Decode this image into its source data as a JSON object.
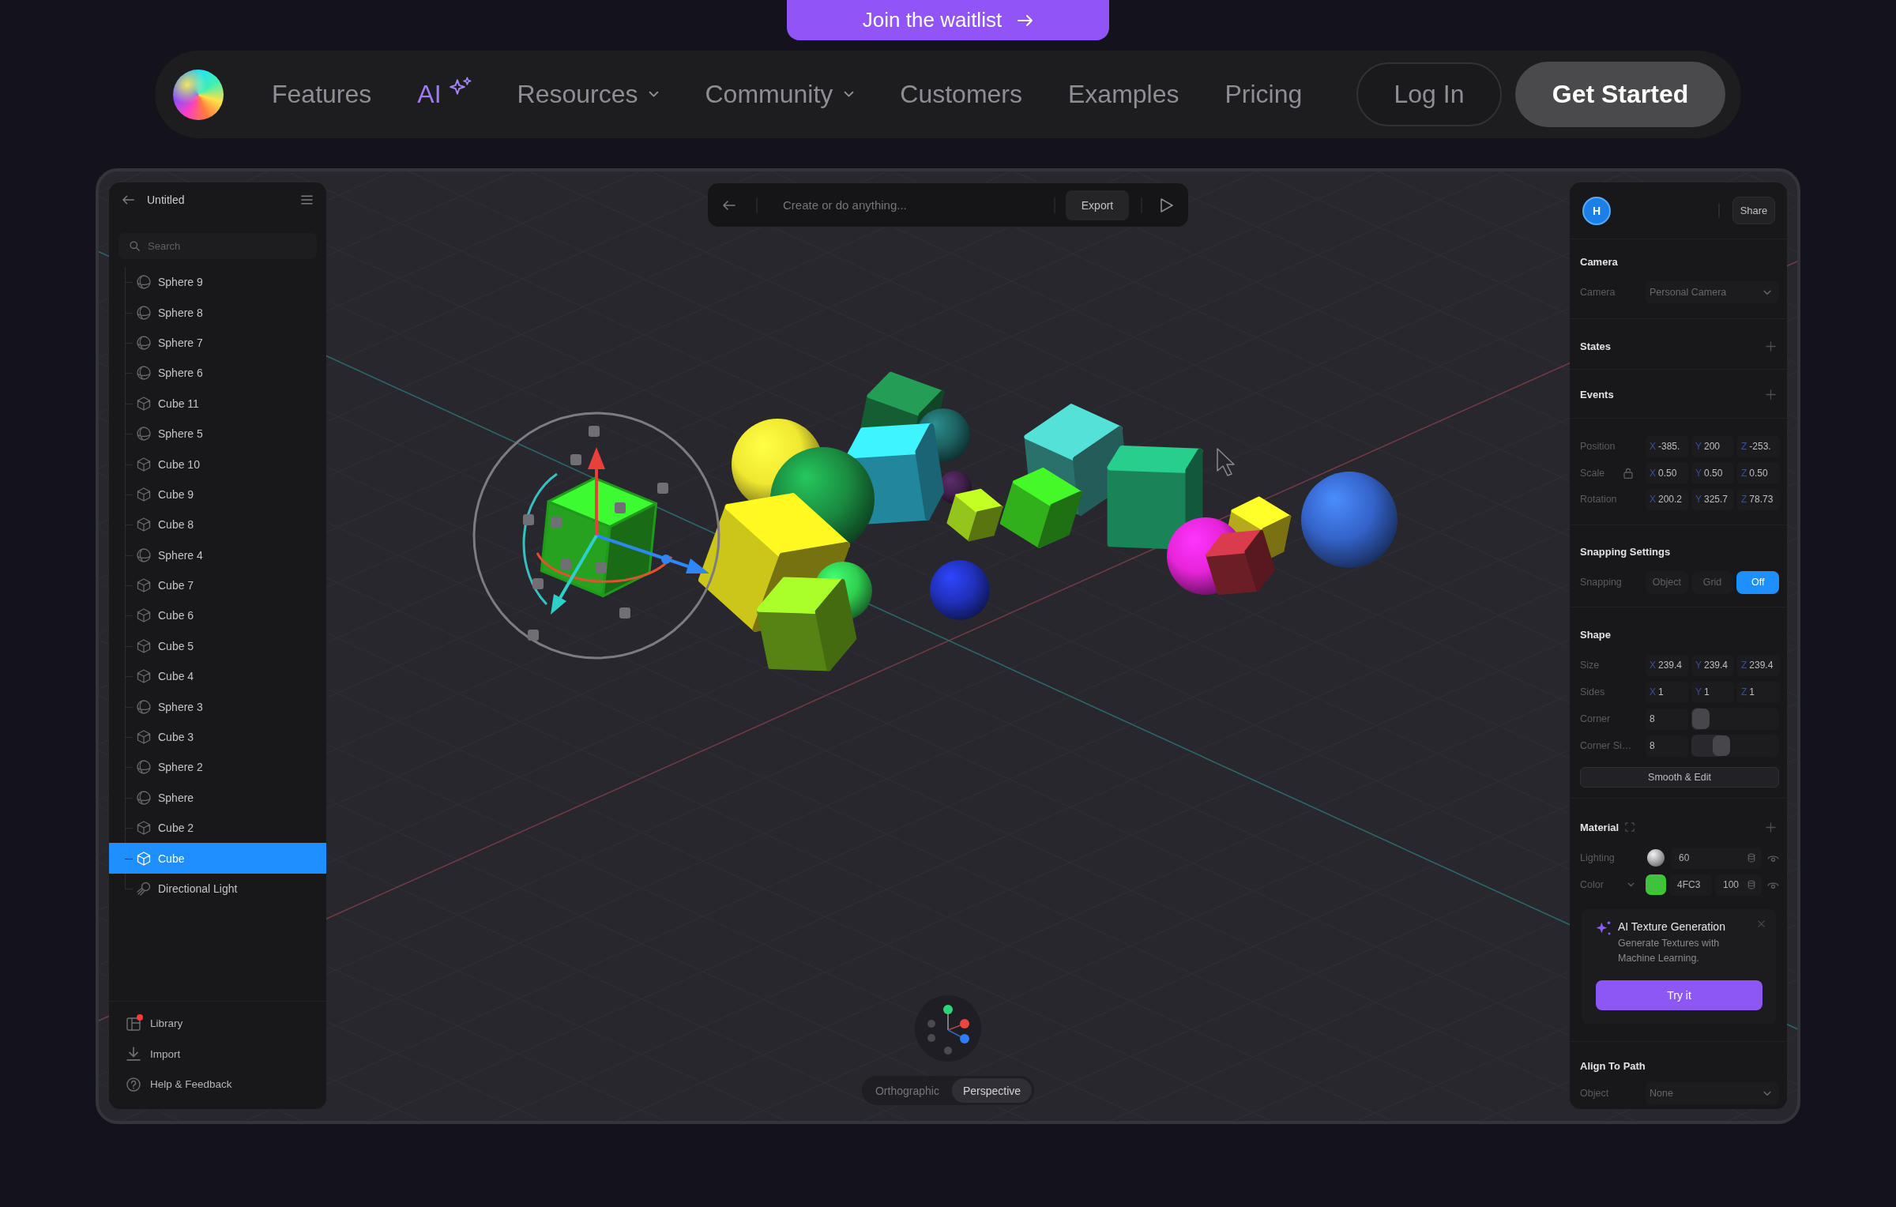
{
  "waitlist_button": {
    "label": "Join the waitlist"
  },
  "nav": {
    "links": [
      {
        "label": "Features",
        "kind": "link"
      },
      {
        "label": "AI",
        "kind": "ai"
      },
      {
        "label": "Resources",
        "kind": "dropdown"
      },
      {
        "label": "Community",
        "kind": "dropdown"
      },
      {
        "label": "Customers",
        "kind": "link"
      },
      {
        "label": "Examples",
        "kind": "link"
      },
      {
        "label": "Pricing",
        "kind": "link"
      }
    ],
    "login": "Log In",
    "cta": "Get Started"
  },
  "layers_panel": {
    "title": "Untitled",
    "search": {
      "placeholder": "Search"
    },
    "layers": [
      {
        "label": "Sphere 9",
        "kind": "sphere",
        "selected": false
      },
      {
        "label": "Sphere 8",
        "kind": "sphere",
        "selected": false
      },
      {
        "label": "Sphere 7",
        "kind": "sphere",
        "selected": false
      },
      {
        "label": "Sphere 6",
        "kind": "sphere",
        "selected": false
      },
      {
        "label": "Cube 11",
        "kind": "cube",
        "selected": false
      },
      {
        "label": "Sphere 5",
        "kind": "sphere",
        "selected": false
      },
      {
        "label": "Cube 10",
        "kind": "cube",
        "selected": false
      },
      {
        "label": "Cube 9",
        "kind": "cube",
        "selected": false
      },
      {
        "label": "Cube 8",
        "kind": "cube",
        "selected": false
      },
      {
        "label": "Sphere 4",
        "kind": "sphere",
        "selected": false
      },
      {
        "label": "Cube 7",
        "kind": "cube",
        "selected": false
      },
      {
        "label": "Cube 6",
        "kind": "cube",
        "selected": false
      },
      {
        "label": "Cube 5",
        "kind": "cube",
        "selected": false
      },
      {
        "label": "Cube 4",
        "kind": "cube",
        "selected": false
      },
      {
        "label": "Sphere 3",
        "kind": "sphere",
        "selected": false
      },
      {
        "label": "Cube 3",
        "kind": "cube",
        "selected": false
      },
      {
        "label": "Sphere 2",
        "kind": "sphere",
        "selected": false
      },
      {
        "label": "Sphere",
        "kind": "sphere",
        "selected": false
      },
      {
        "label": "Cube 2",
        "kind": "cube",
        "selected": false
      },
      {
        "label": "Cube",
        "kind": "cube",
        "selected": true
      },
      {
        "label": "Directional Light",
        "kind": "light",
        "selected": false
      }
    ],
    "footer": [
      {
        "label": "Library",
        "kind": "library",
        "notification": true
      },
      {
        "label": "Import",
        "kind": "import",
        "notification": false
      },
      {
        "label": "Help & Feedback",
        "kind": "help",
        "notification": false
      }
    ]
  },
  "toolbar": {
    "prompt": {
      "placeholder": "Create or do anything..."
    },
    "export": "Export"
  },
  "view_modes": [
    {
      "label": "Orthographic",
      "selected": false
    },
    {
      "label": "Perspective",
      "selected": true
    }
  ],
  "inspector": {
    "avatar": "H",
    "share": "Share",
    "camera": {
      "title": "Camera",
      "label": "Camera",
      "value": "Personal Camera"
    },
    "states": {
      "title": "States"
    },
    "events": {
      "title": "Events"
    },
    "transform": [
      {
        "label": "Position",
        "lock": false,
        "values": [
          {
            "axis": "X",
            "value": "-385."
          },
          {
            "axis": "Y",
            "value": "200"
          },
          {
            "axis": "Z",
            "value": "-253."
          }
        ]
      },
      {
        "label": "Scale",
        "lock": true,
        "values": [
          {
            "axis": "X",
            "value": "0.50"
          },
          {
            "axis": "Y",
            "value": "0.50"
          },
          {
            "axis": "Z",
            "value": "0.50"
          }
        ]
      },
      {
        "label": "Rotation",
        "lock": false,
        "values": [
          {
            "axis": "X",
            "value": "200.2"
          },
          {
            "axis": "Y",
            "value": "325.7"
          },
          {
            "axis": "Z",
            "value": "78.73"
          }
        ]
      }
    ],
    "snapping": {
      "title": "Snapping Settings",
      "label": "Snapping",
      "options": [
        {
          "label": "Object",
          "selected": false
        },
        {
          "label": "Grid",
          "selected": false
        },
        {
          "label": "Off",
          "selected": true
        }
      ]
    },
    "shape": {
      "title": "Shape",
      "rows": [
        {
          "kind": "xyz",
          "label": "Size",
          "values": [
            {
              "axis": "X",
              "value": "239.4"
            },
            {
              "axis": "Y",
              "value": "239.4"
            },
            {
              "axis": "Z",
              "value": "239.4"
            }
          ]
        },
        {
          "kind": "xyz",
          "label": "Sides",
          "values": [
            {
              "axis": "X",
              "value": "1"
            },
            {
              "axis": "Y",
              "value": "1"
            },
            {
              "axis": "Z",
              "value": "1"
            }
          ]
        },
        {
          "kind": "slider",
          "label": "Corner",
          "value": "8",
          "level": 0
        },
        {
          "kind": "slider",
          "label": "Corner Si…",
          "value": "8",
          "level": 0.3
        }
      ],
      "button": "Smooth & Edit"
    },
    "material": {
      "title": "Material",
      "rows": [
        {
          "kind": "lighting",
          "label": "Lighting",
          "value": "60"
        },
        {
          "kind": "color",
          "label": "Color",
          "color": "#3ec43a",
          "hex": "4FC3",
          "opacity": "100"
        }
      ]
    },
    "ai_card": {
      "title": "AI Texture Generation",
      "text": "Generate Textures with Machine Learning.",
      "button": "Try it"
    },
    "align_to_path": {
      "title": "Align To Path",
      "label": "Object",
      "value": "None"
    }
  }
}
